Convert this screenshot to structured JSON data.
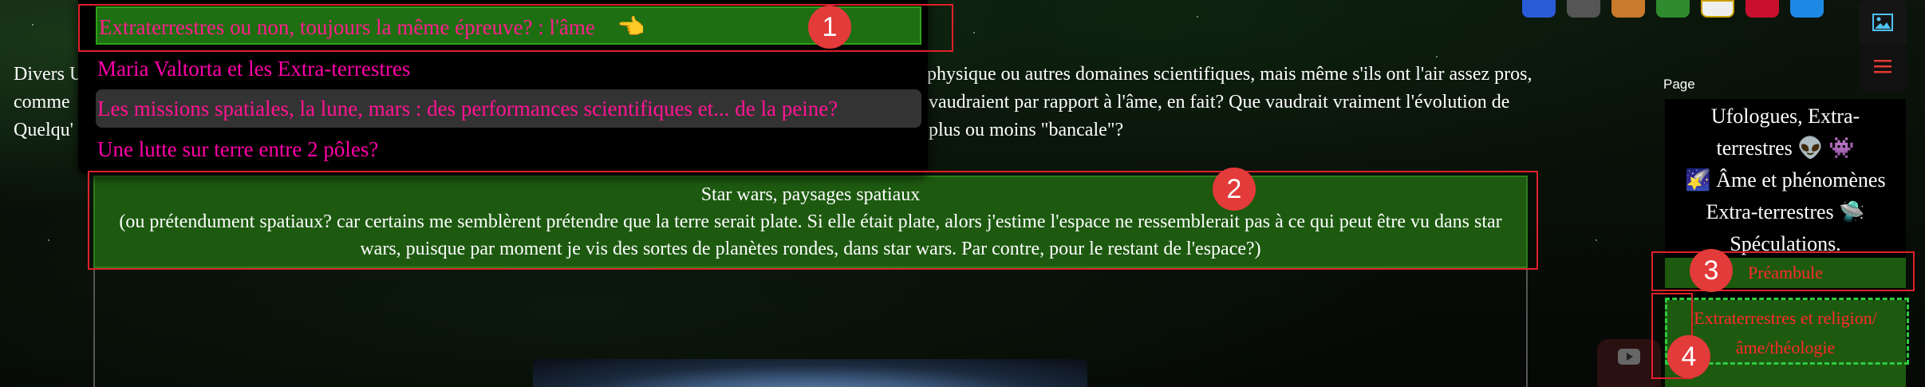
{
  "intro": {
    "line1_left": "Divers U",
    "line1_right": "physique ou autres domaines scientifiques, mais même s'ils ont l'air assez pros,",
    "line2_left": "comme",
    "line2_right": "vaudraient par rapport à l'âme, en fait? Que vaudrait vraiment l'évolution de",
    "line3_left": "Quelqu'",
    "line3_right": "plus ou moins \"bancale\"?"
  },
  "dropdown": {
    "items": [
      {
        "label": "Extraterrestres ou non, toujours la même épreuve? : l'âme",
        "icon": "pointing-hand-icon",
        "glyph": "👈",
        "state": "active"
      },
      {
        "label": "Maria Valtorta et les Extra-terrestres",
        "state": "normal"
      },
      {
        "label": "Les missions spatiales, la lune, mars : des performances scientifiques et... de la peine?",
        "state": "hover"
      },
      {
        "label": "Une lutte sur terre entre 2 pôles?",
        "state": "normal"
      }
    ]
  },
  "badges": [
    "1",
    "2",
    "3",
    "4"
  ],
  "starwars": {
    "title": "Star wars, paysages spatiaux",
    "body": "(ou prétendument spatiaux? car certains me semblèrent prétendre que la terre serait plate. Si elle était plate, alors j'estime l'espace ne ressemblerait pas à ce qui peut être vu dans star wars, puisque par moment je vis des sortes de planètes rondes, dans star wars. Par contre, pour le restant de l'espace?)"
  },
  "sidebar": {
    "label": "Page",
    "title_lines": [
      "Ufologues, Extra-",
      "terrestres 👽 👾",
      "🌠 Âme et phénomènes",
      "Extra-terrestres 🛸",
      "Spéculations."
    ],
    "links": [
      "Préambule",
      "Extraterrestres et religion/",
      "âme/théologie"
    ]
  },
  "colors": {
    "accent_green": "#1d5a10",
    "link_pink": "#ff00a8",
    "annotation_red": "#e0202a",
    "sidebar_link_red": "#ff2a2a"
  },
  "icons": {
    "toolbar": [
      "app-icon-blue",
      "app-icon-gray",
      "app-icon-orange",
      "app-icon-green",
      "app-icon-white",
      "app-icon-red",
      "app-icon-cyan"
    ],
    "right": [
      "image-icon",
      "hamburger-menu-icon",
      "youtube-icon"
    ]
  }
}
